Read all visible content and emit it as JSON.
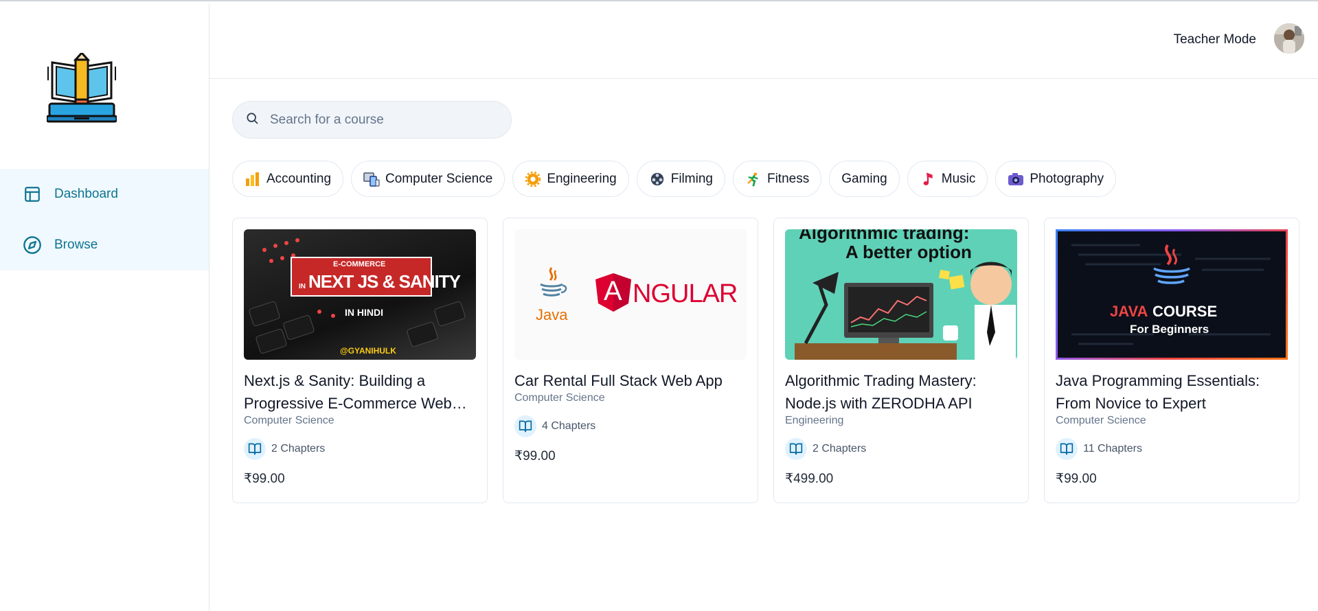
{
  "sidebar": {
    "logo_icon": "laptop-book-pencil-logo",
    "nav": [
      {
        "label": "Dashboard",
        "icon": "layout-icon"
      },
      {
        "label": "Browse",
        "icon": "compass-icon"
      }
    ]
  },
  "header": {
    "teacher_mode_label": "Teacher Mode",
    "avatar_icon": "user-avatar"
  },
  "search": {
    "placeholder": "Search for a course",
    "value": ""
  },
  "categories": [
    {
      "label": "Accounting",
      "icon": "bar-chart-emoji"
    },
    {
      "label": "Computer Science",
      "icon": "computer-devices-emoji"
    },
    {
      "label": "Engineering",
      "icon": "gear-emoji"
    },
    {
      "label": "Filming",
      "icon": "film-reel-emoji"
    },
    {
      "label": "Fitness",
      "icon": "runner-emoji"
    },
    {
      "label": "Gaming",
      "icon": ""
    },
    {
      "label": "Music",
      "icon": "music-note-emoji"
    },
    {
      "label": "Photography",
      "icon": "camera-emoji"
    }
  ],
  "courses": [
    {
      "title": "Next.js & Sanity: Building a Progressive E-Commerce Web…",
      "category": "Computer Science",
      "chapters": "2 Chapters",
      "price": "₹99.00",
      "thumb": {
        "top": "E-COMMERCE",
        "prefix": "IN",
        "main": "NEXT JS & SANITY",
        "sub": "IN HINDI",
        "handle": "@GYANIHULK"
      }
    },
    {
      "title": "Car Rental Full Stack Web App",
      "category": "Computer Science",
      "chapters": "4 Chapters",
      "price": "₹99.00",
      "thumb": {
        "java": "Java",
        "angular": "NGULAR",
        "angular_letter": "A"
      }
    },
    {
      "title": "Algorithmic Trading Mastery: Node.js with ZERODHA API",
      "category": "Engineering",
      "chapters": "2 Chapters",
      "price": "₹499.00",
      "thumb": {
        "line1": "Algorithmic trading:",
        "line2": "A better option"
      }
    },
    {
      "title": "Java Programming Essentials: From Novice to Expert",
      "category": "Computer Science",
      "chapters": "11 Chapters",
      "price": "₹99.00",
      "thumb": {
        "java": "JAVA",
        "course": "COURSE",
        "sub": "For Beginners"
      }
    }
  ],
  "colors": {
    "accent": "#0e7490",
    "nav_active_bg": "#f0f9ff",
    "chip_border": "#e2e8f0",
    "search_bg": "#f1f5f9",
    "angular_red": "#dd0031",
    "trading_teal": "#5fd1b7"
  }
}
